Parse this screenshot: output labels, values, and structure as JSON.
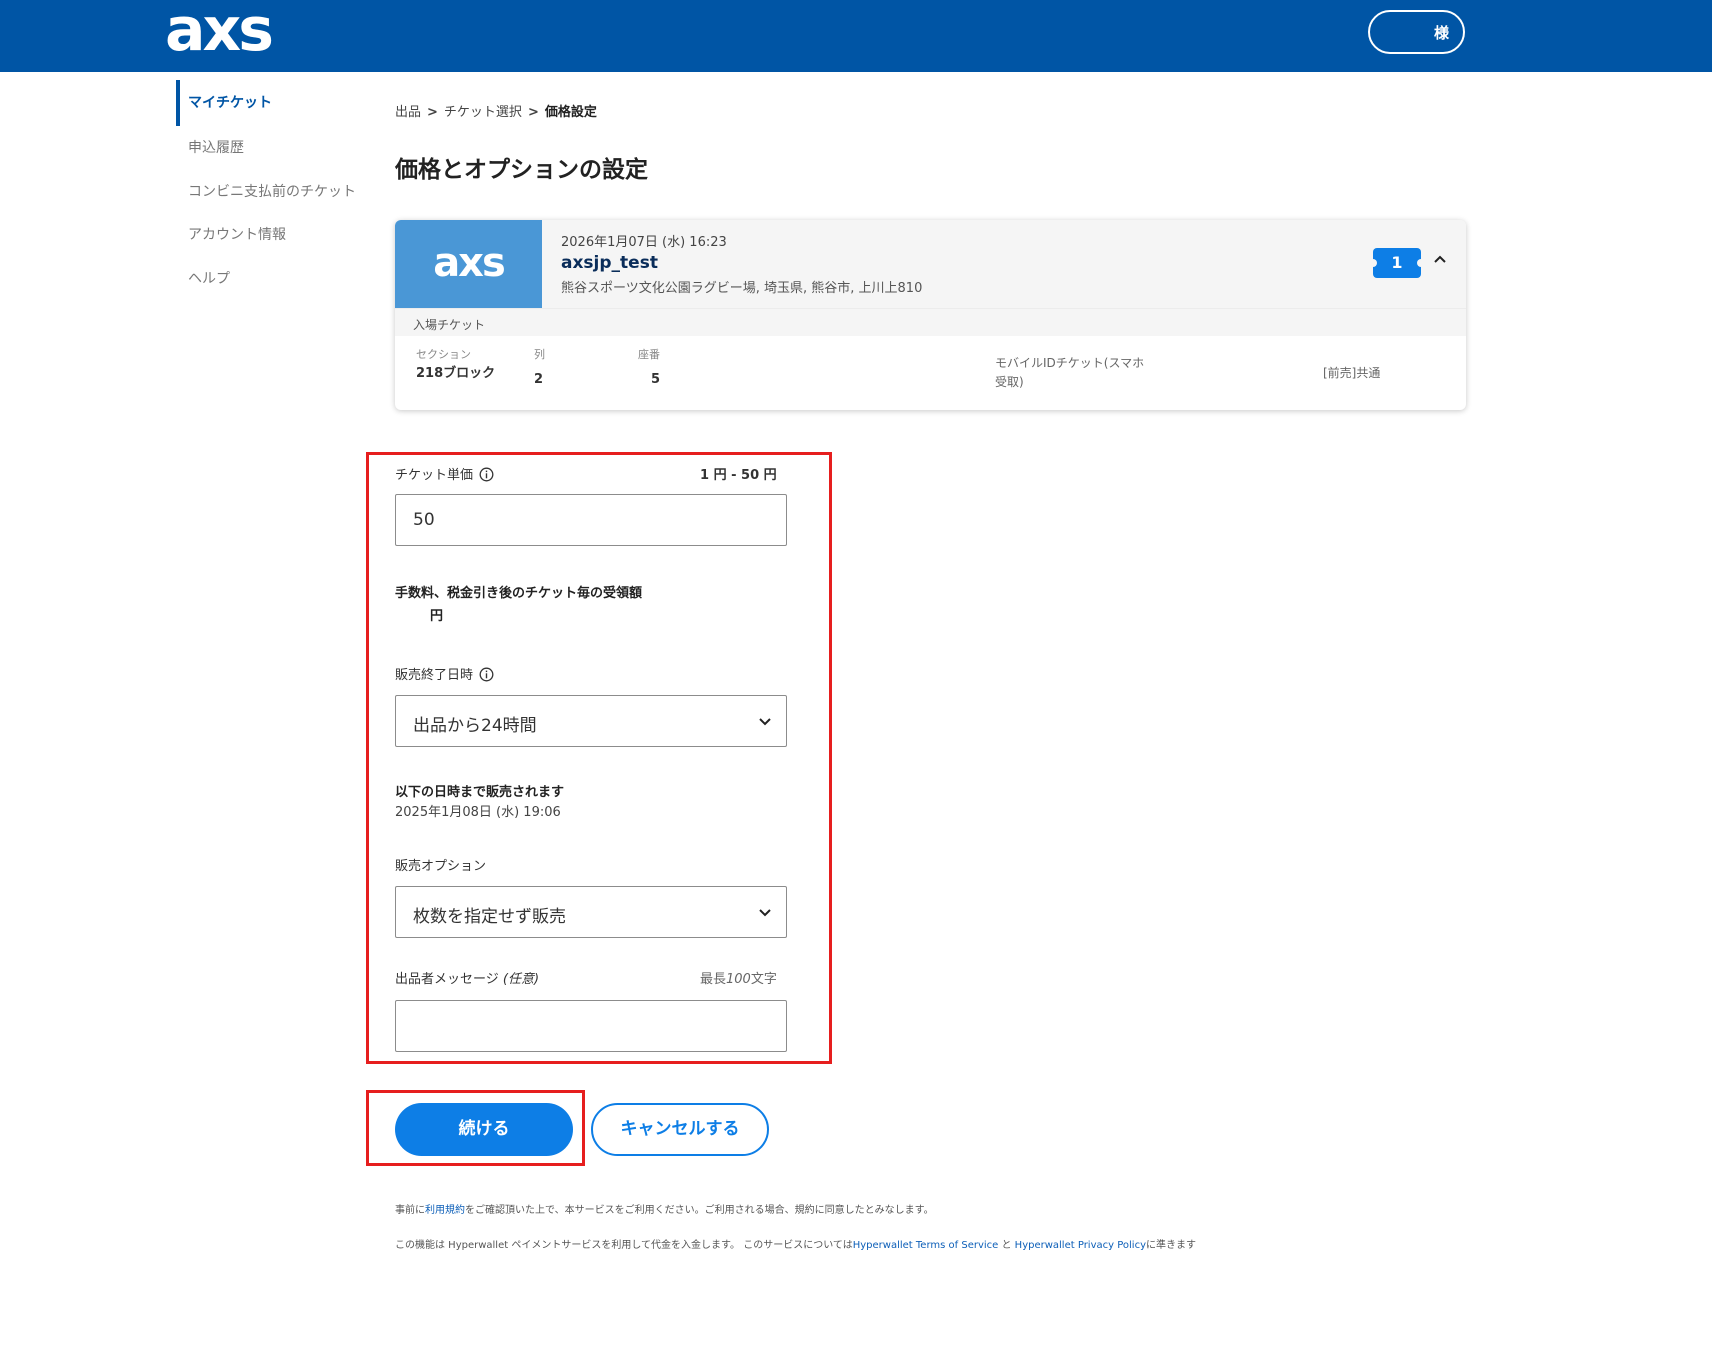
{
  "header": {
    "logo": "axs",
    "user_suffix": "様"
  },
  "sidebar": {
    "items": [
      {
        "label": "マイチケット",
        "active": true
      },
      {
        "label": "申込履歴"
      },
      {
        "label": "コンビニ支払前のチケット"
      },
      {
        "label": "アカウント情報"
      },
      {
        "label": "ヘルプ"
      }
    ]
  },
  "breadcrumb": {
    "items": [
      "出品",
      "チケット選択",
      "価格設定"
    ],
    "separator": ">"
  },
  "page_title": "価格とオプションの設定",
  "event": {
    "logo": "axs",
    "datetime": "2026年1月07日 (水) 16:23",
    "name": "axsjp_test",
    "venue": "熊谷スポーツ文化公園ラグビー場, 埼玉県, 熊谷市, 上川上810",
    "ticket_count": "1",
    "ticket_type": "入場チケット",
    "section_label": "セクション",
    "section_value": "218ブロック",
    "row_label": "列",
    "row_value": "2",
    "seat_label": "座番",
    "seat_value": "5",
    "mobile_type": "モバイルIDチケット(スマホ受取)",
    "presale": "[前売]共通"
  },
  "form": {
    "price_label": "チケット単価",
    "price_range": "1 円 - 50 円",
    "price_value": "50",
    "net_label": "手数料、税金引き後のチケット毎の受領額",
    "net_unit": "円",
    "end_label": "販売終了日時",
    "end_selected": "出品から24時間",
    "until_label": "以下の日時まで販売されます",
    "until_value": "2025年1月08日 (水) 19:06",
    "option_label": "販売オプション",
    "option_selected": "枚数を指定せず販売",
    "message_label": "出品者メッセージ",
    "message_optional": "(任意)",
    "message_limit_prefix": "最長",
    "message_limit_num": "100",
    "message_limit_suffix": "文字",
    "message_value": ""
  },
  "buttons": {
    "continue": "続ける",
    "cancel": "キャンセルする"
  },
  "footer": {
    "terms_prefix": "事前に",
    "terms_link": "利用規約",
    "terms_suffix": "をご確認頂いた上で、本サービスをご利用ください。ご利用される場合、規約に同意したとみなします。",
    "hw_prefix": "この機能は Hyperwallet ペイメントサービスを利用して代金を入金します。 このサービスについては",
    "hw_terms_link": "Hyperwallet Terms of Service",
    "hw_and": " と ",
    "hw_privacy_link": "Hyperwallet Privacy Policy",
    "hw_suffix": "に準きます"
  },
  "colors": {
    "brand": "#0055a5",
    "accent": "#0d7ee6",
    "highlight": "#e61e1e"
  }
}
